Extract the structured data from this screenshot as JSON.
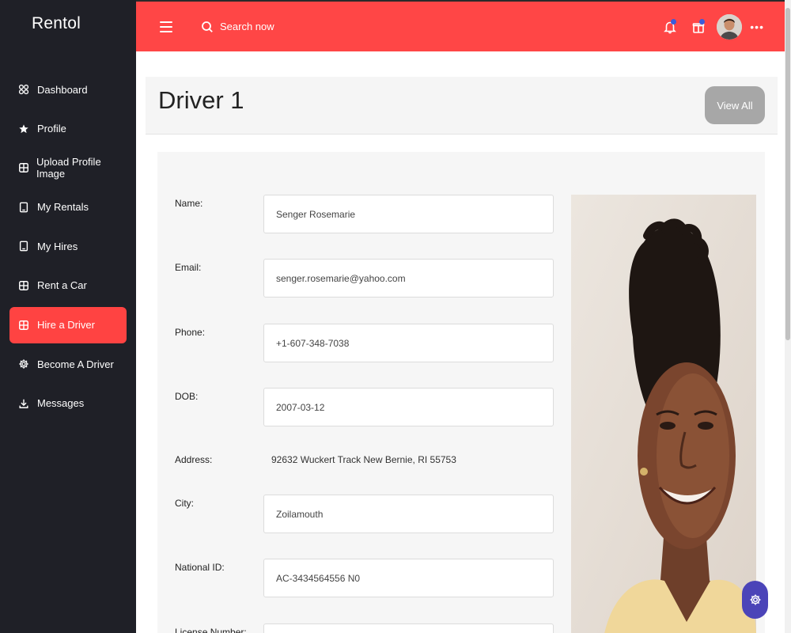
{
  "app": {
    "brand": "Rentol"
  },
  "sidebar": {
    "items": [
      {
        "label": "Dashboard",
        "icon": "dashboard-icon"
      },
      {
        "label": "Profile",
        "icon": "star-icon"
      },
      {
        "label": "Upload Profile Image",
        "icon": "grid-icon"
      },
      {
        "label": "My Rentals",
        "icon": "device-icon"
      },
      {
        "label": "My Hires",
        "icon": "device-icon"
      },
      {
        "label": "Rent a Car",
        "icon": "grid-icon"
      },
      {
        "label": "Hire a Driver",
        "icon": "grid-icon",
        "active": true
      },
      {
        "label": "Become A Driver",
        "icon": "gear-icon"
      },
      {
        "label": "Messages",
        "icon": "download-icon"
      }
    ]
  },
  "topbar": {
    "search_placeholder": "Search now",
    "more_label": "•••"
  },
  "page": {
    "title": "Driver 1",
    "view_all_label": "View All"
  },
  "driver": {
    "name_label": "Name:",
    "name_value": "Senger Rosemarie",
    "email_label": "Email:",
    "email_value": "senger.rosemarie@yahoo.com",
    "phone_label": "Phone:",
    "phone_value": "+1-607-348-7038",
    "dob_label": "DOB:",
    "dob_value": "2007-03-12",
    "address_label": "Address:",
    "address_value": "92632 Wuckert Track New Bernie, RI 55753",
    "city_label": "City:",
    "city_value": "Zoilamouth",
    "national_id_label": "National ID:",
    "national_id_value": "AC-3434564556 N0",
    "license_label": "License Number:"
  },
  "colors": {
    "accent": "#ff4646",
    "sidebar_bg": "#1f2027",
    "active_item": "#ff4342",
    "fab": "#4b44b8",
    "view_all_bg": "#a7a7a7"
  }
}
